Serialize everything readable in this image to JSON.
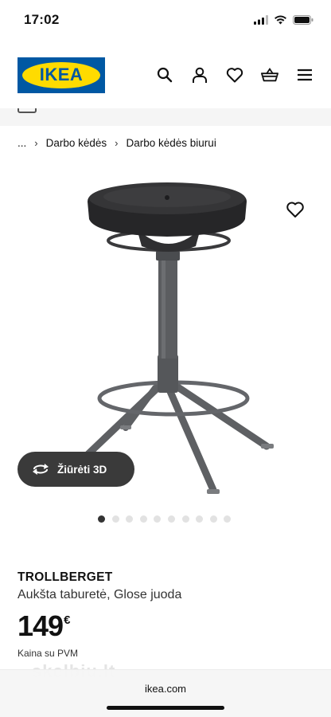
{
  "status_bar": {
    "time": "17:02"
  },
  "header": {
    "logo_text": "IKEA",
    "icons": [
      "search-icon",
      "user-icon",
      "heart-icon",
      "basket-icon",
      "menu-icon"
    ]
  },
  "breadcrumb": {
    "ellipsis": "...",
    "items": [
      "Darbo kėdės",
      "Darbo kėdės biurui"
    ]
  },
  "gallery": {
    "view_3d_label": "Žiūrėti 3D",
    "image_count": 10,
    "active_index": 0
  },
  "product": {
    "name": "TROLLBERGET",
    "description": "Aukšta taburetė, Glose juoda",
    "price": "149",
    "currency": "€",
    "price_note": "Kaina su PVM"
  },
  "watermark": "skelbiu.lt",
  "browser": {
    "domain": "ikea.com"
  },
  "colors": {
    "brand_blue": "#0058a3",
    "brand_yellow": "#ffdb00"
  }
}
